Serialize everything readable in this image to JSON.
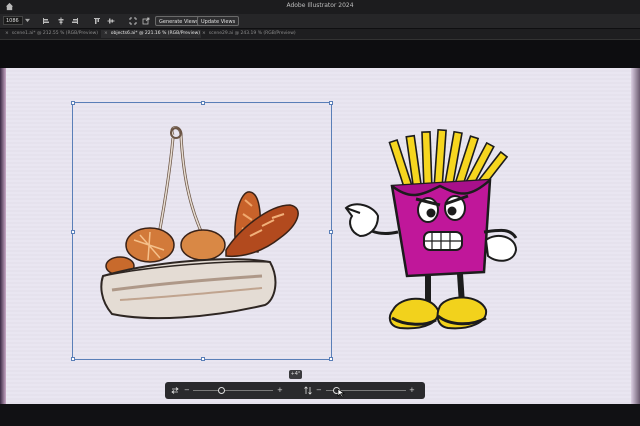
{
  "app": {
    "title": "Adobe Illustrator 2024"
  },
  "toolbar": {
    "zoom_value": "1086",
    "generate_views_label": "Generate Views",
    "update_views_label": "Update Views"
  },
  "tabs": [
    {
      "label": "scene1.ai* @ 212.55 % (RGB/Preview)",
      "active": false
    },
    {
      "label": "objects6.ai* @ 221.16 % (RGB/Preview)",
      "active": true
    },
    {
      "label": "scene29.ai @ 243.19 % (RGB/Preview)",
      "active": false
    }
  ],
  "canvas": {
    "background": "#e9e6f1",
    "selection_color": "#5a7fb8",
    "size_chip": "+4°"
  },
  "artwork": [
    {
      "name": "bread-basket-illustration"
    },
    {
      "name": "french-fries-character-illustration",
      "colors": {
        "box": "#c0179a",
        "fries": "#f6d61f",
        "shoes": "#f2d21c"
      }
    }
  ],
  "controls": {
    "left_group": {
      "minus": "−",
      "plus": "+",
      "level": 0.35
    },
    "right_group": {
      "minus": "−",
      "plus": "+",
      "level": 0.12
    }
  }
}
